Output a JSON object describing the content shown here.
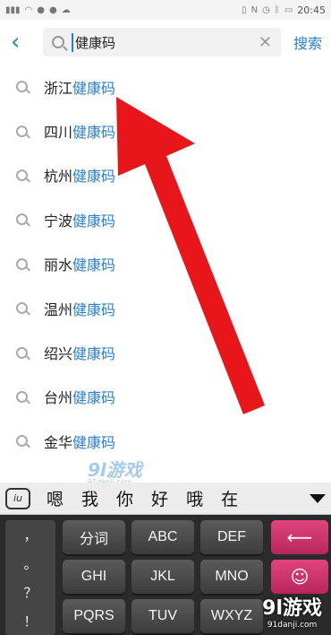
{
  "status_bar": {
    "left_icons": [
      "signal-icon",
      "wifi-icon",
      "app-icon",
      "app-icon",
      "cloud-icon"
    ],
    "right_icons": [
      "vibrate-icon",
      "nfc-icon",
      "alarm-icon",
      "bluetooth-icon",
      "battery-icon"
    ],
    "time": "20:45"
  },
  "search": {
    "query": "健康码",
    "clear_symbol": "✕",
    "back_symbol": "‹",
    "submit_label": "搜索"
  },
  "suggestions": [
    {
      "prefix": "浙江",
      "highlight": "健康码"
    },
    {
      "prefix": "四川",
      "highlight": "健康码"
    },
    {
      "prefix": "杭州",
      "highlight": "健康码"
    },
    {
      "prefix": "宁波",
      "highlight": "健康码"
    },
    {
      "prefix": "丽水",
      "highlight": "健康码"
    },
    {
      "prefix": "温州",
      "highlight": "健康码"
    },
    {
      "prefix": "绍兴",
      "highlight": "健康码"
    },
    {
      "prefix": "台州",
      "highlight": "健康码"
    },
    {
      "prefix": "金华",
      "highlight": "健康码"
    }
  ],
  "keyboard": {
    "logo": "iu",
    "candidates": [
      "嗯",
      "我",
      "你",
      "好",
      "哦",
      "在"
    ],
    "punctuation": [
      "，",
      "。",
      "？",
      "！"
    ],
    "keys": [
      "分词",
      "ABC",
      "DEF",
      "GHI",
      "JKL",
      "MNO",
      "PQRS",
      "TUV",
      "WXYZ"
    ],
    "backspace_symbol": "⟵",
    "emoji_symbol": "☺"
  },
  "annotation_color": "#e8161b",
  "watermark": {
    "mid_logo": "9l游戏",
    "mid_url": "91danji.com",
    "corner_logo": "9l游戏",
    "corner_url": "91danji.com"
  }
}
